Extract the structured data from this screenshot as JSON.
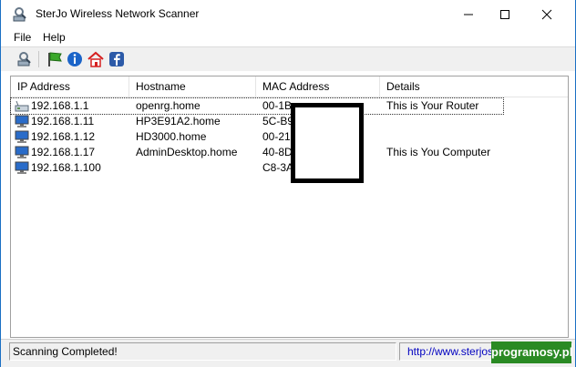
{
  "window": {
    "title": "SterJo Wireless Network Scanner"
  },
  "menu": {
    "file": "File",
    "help": "Help"
  },
  "toolbar": {
    "icons": [
      "scan-icon",
      "flag-icon",
      "info-icon",
      "home-icon",
      "facebook-icon"
    ]
  },
  "table": {
    "headers": [
      "IP Address",
      "Hostname",
      "MAC Address",
      "Details"
    ],
    "rows": [
      {
        "ip": "192.168.1.1",
        "host": "openrg.home",
        "mac": "00-1B-",
        "details": "This is Your Router",
        "icon": "router-icon"
      },
      {
        "ip": "192.168.1.11",
        "host": "HP3E91A2.home",
        "mac": "5C-B9",
        "details": "",
        "icon": "computer-icon"
      },
      {
        "ip": "192.168.1.12",
        "host": "HD3000.home",
        "mac": "00-21-",
        "details": "",
        "icon": "computer-icon"
      },
      {
        "ip": "192.168.1.17",
        "host": "AdminDesktop.home",
        "mac": "40-8D",
        "details": "This is You Computer",
        "icon": "computer-icon"
      },
      {
        "ip": "192.168.1.100",
        "host": "",
        "mac": "C8-3A",
        "details": "",
        "icon": "computer-icon"
      }
    ]
  },
  "status": {
    "text": "Scanning Completed!",
    "link": "http://www.sterjosoft.com"
  },
  "watermark": "programosy.pl",
  "colors": {
    "accent": "#1a6fc4",
    "link": "#0000c0",
    "badge": "#2a8a24"
  }
}
